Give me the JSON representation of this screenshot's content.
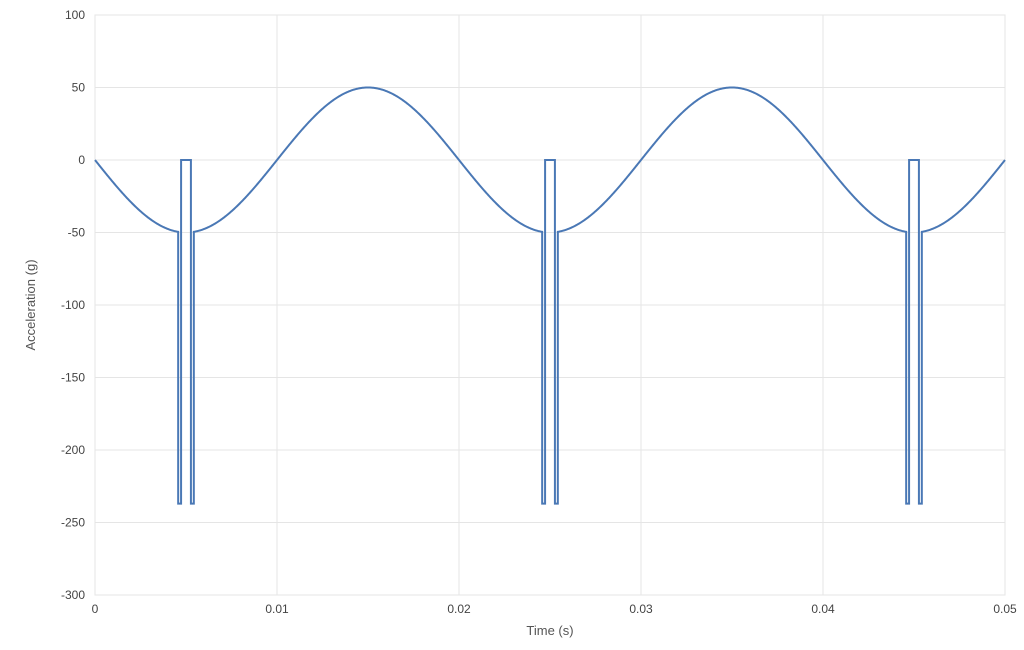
{
  "chart_data": {
    "type": "line",
    "xlabel": "Time (s)",
    "ylabel": "Acceleration (g)",
    "xlim": [
      0,
      0.05
    ],
    "ylim": [
      -300,
      100
    ],
    "xticks": [
      0,
      0.01,
      0.02,
      0.03,
      0.04,
      0.05
    ],
    "yticks": [
      -300,
      -250,
      -200,
      -150,
      -100,
      -50,
      0,
      50,
      100
    ],
    "grid": true,
    "series": [
      {
        "name": "acceleration",
        "description": "-50·sin(2π·50·t) baseline with paired negative spikes to ≈ -237 g near t ≈ 0.005, 0.025, 0.045 s (with a brief return to ~0 between each spike pair)",
        "sine_amplitude": -50,
        "sine_frequency_hz": 50,
        "spikes": [
          {
            "t_center": 0.005,
            "pair_offset": 0.00035,
            "depth": -237,
            "mid_return": 0
          },
          {
            "t_center": 0.025,
            "pair_offset": 0.00035,
            "depth": -237,
            "mid_return": 0
          },
          {
            "t_center": 0.045,
            "pair_offset": 0.00035,
            "depth": -237,
            "mid_return": 0
          }
        ]
      }
    ],
    "line_color": "#4a78b5"
  }
}
